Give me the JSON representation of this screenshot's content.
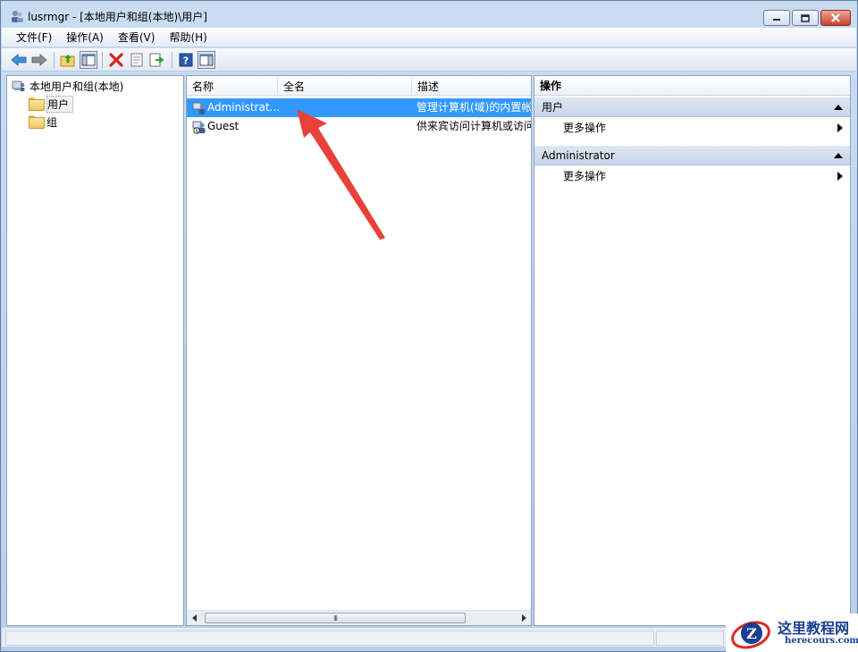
{
  "window": {
    "title": "lusrmgr - [本地用户和组(本地)\\用户]"
  },
  "menu": [
    "文件(F)",
    "操作(A)",
    "查看(V)",
    "帮助(H)"
  ],
  "toolbar": {
    "icons": [
      "back-icon",
      "forward-icon",
      "up-folder-icon",
      "show-tree-icon",
      "delete-icon",
      "properties-icon",
      "export-icon",
      "help-icon",
      "show-action-pane-icon"
    ]
  },
  "tree": {
    "root": "本地用户和组(本地)",
    "items": [
      "用户",
      "组"
    ]
  },
  "list": {
    "columns": [
      "名称",
      "全名",
      "描述"
    ],
    "rows": [
      {
        "name": "Administrat...",
        "fullname": "",
        "description": "管理计算机(域)的内置帐"
      },
      {
        "name": "Guest",
        "fullname": "",
        "description": "供来宾访问计算机或访问"
      }
    ],
    "selected_row": 0,
    "scroll_grip": "III"
  },
  "actions": {
    "title": "操作",
    "sections": [
      {
        "header": "用户",
        "item": "更多操作"
      },
      {
        "header": "Administrator",
        "item": "更多操作"
      }
    ]
  },
  "watermark": {
    "text": "这里教程网",
    "url": "herecours.com"
  },
  "colors": {
    "selection": "#3399ff",
    "annotation_arrow": "#e8413a",
    "window_frame": "#b9cfea"
  }
}
